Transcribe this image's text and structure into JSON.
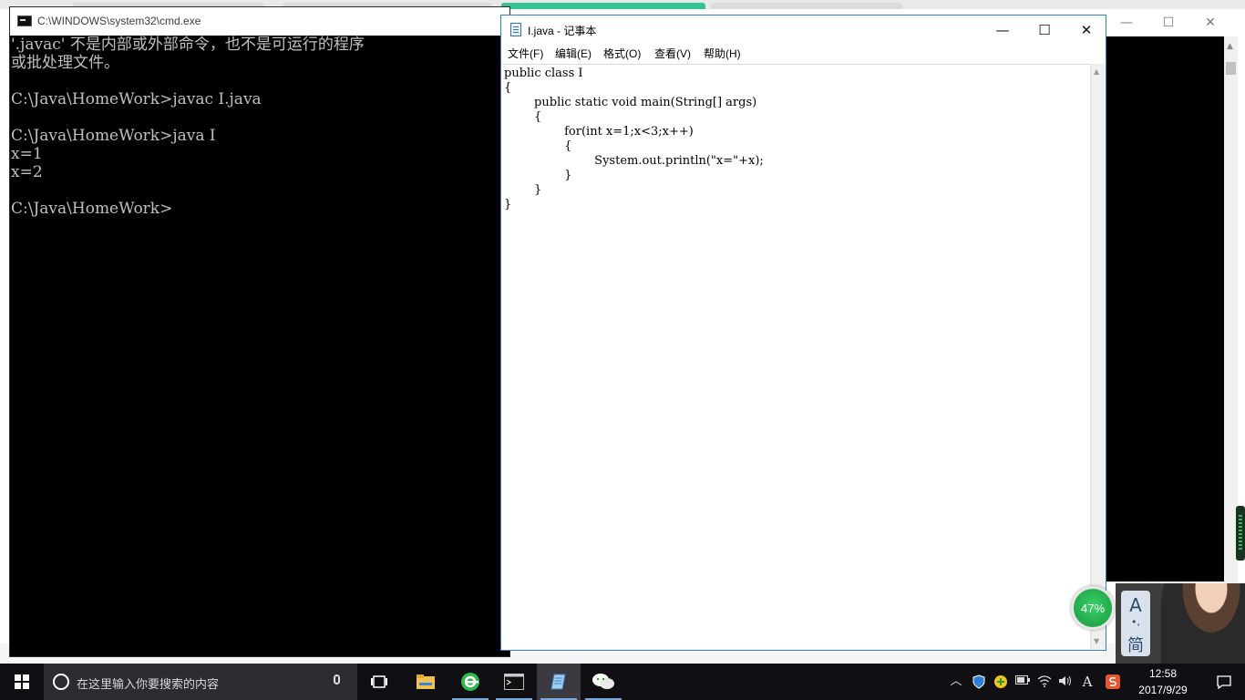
{
  "cmd": {
    "title": "C:\\WINDOWS\\system32\\cmd.exe",
    "lines": [
      "'.javac' 不是内部或外部命令，也不是可运行的程序",
      "或批处理文件。",
      "",
      "C:\\Java\\HomeWork>javac I.java",
      "",
      "C:\\Java\\HomeWork>java I",
      "x=1",
      "x=2",
      "",
      "C:\\Java\\HomeWork>"
    ]
  },
  "notepad": {
    "title": "I.java - 记事本",
    "menu": [
      "文件(F)",
      "编辑(E)",
      "格式(O)",
      "查看(V)",
      "帮助(H)"
    ],
    "content": "public class I\n{\n        public static void main(String[] args)\n        {\n                for(int x=1;x<3;x++)\n                {\n                        System.out.println(\"x=\"+x);\n                }\n        }\n}",
    "controls": {
      "minimize": "—",
      "maximize": "☐",
      "close": "✕"
    }
  },
  "speed_ball": {
    "label": "47%",
    "value": 47
  },
  "ime": {
    "mode_glyph": "A",
    "dot_glyph": "•,",
    "script_glyph": "简"
  },
  "taskbar": {
    "search_placeholder": "在这里输入你要搜索的内容",
    "apps": [
      {
        "name": "task-view",
        "icon": "task-view-icon"
      },
      {
        "name": "file-explorer",
        "icon": "folder-icon"
      },
      {
        "name": "360-browser",
        "icon": "browser-icon"
      },
      {
        "name": "cmd",
        "icon": "terminal-icon"
      },
      {
        "name": "notepad",
        "icon": "notepad-icon"
      },
      {
        "name": "wechat",
        "icon": "wechat-icon"
      }
    ],
    "ime_letter": "A",
    "time": "12:58",
    "date": "2017/9/29"
  },
  "colors": {
    "cmd_text": "#c0c0c0",
    "notepad_border": "#2f7fd0",
    "taskbar": "#101014",
    "speed_green": "#1fa84a"
  }
}
